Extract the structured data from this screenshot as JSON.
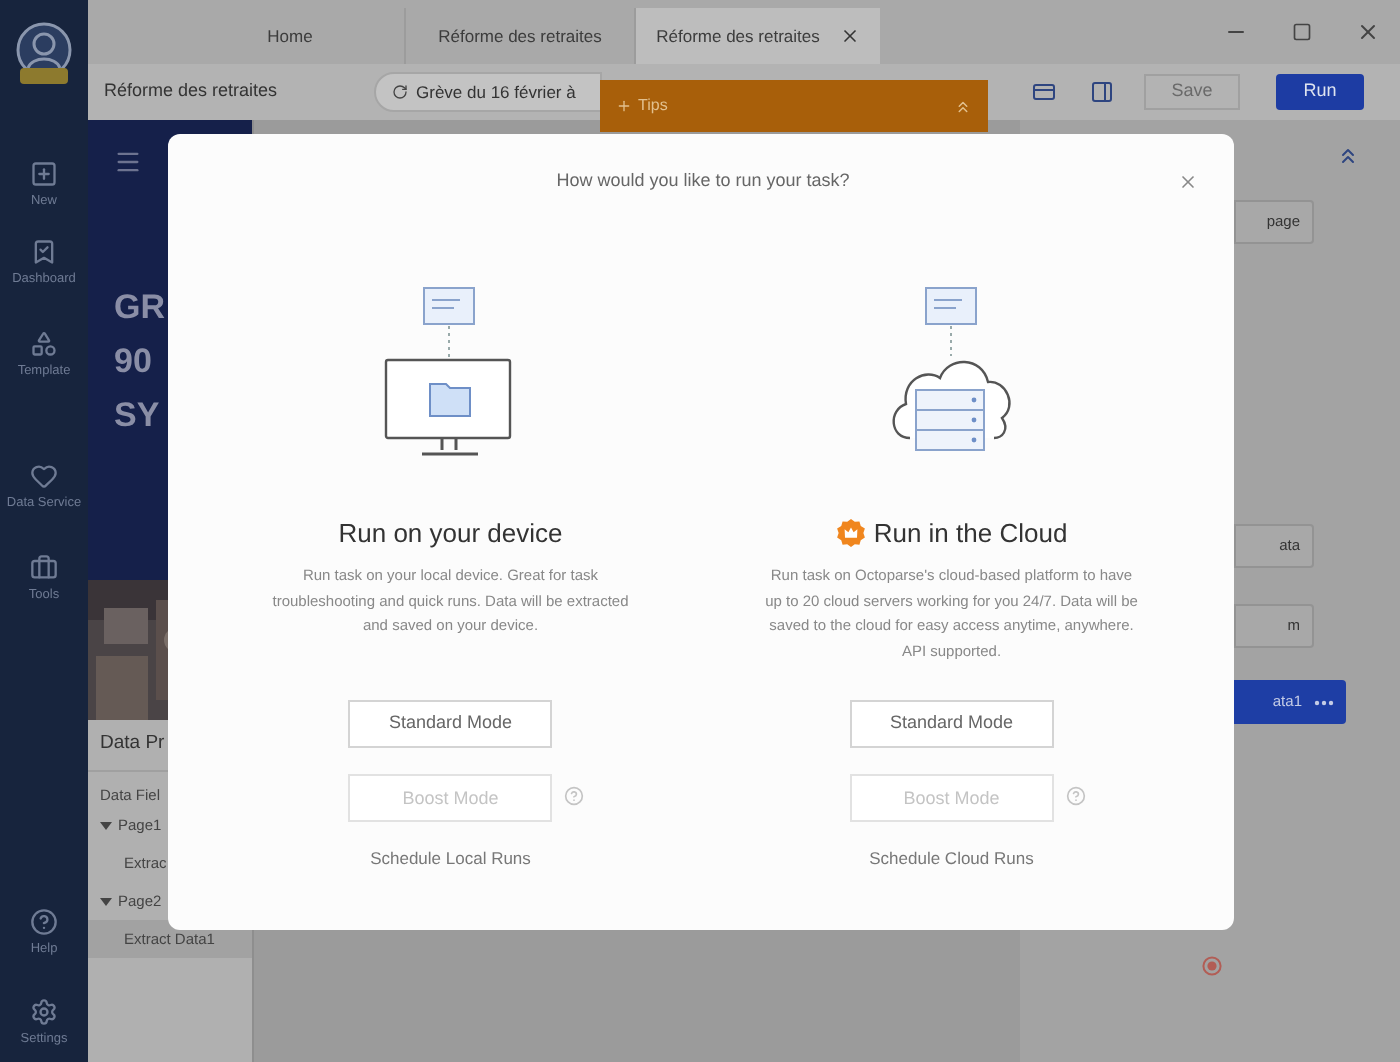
{
  "sidebar": {
    "items": [
      {
        "label": "New"
      },
      {
        "label": "Dashboard"
      },
      {
        "label": "Template"
      },
      {
        "label": "Data Service"
      },
      {
        "label": "Tools"
      }
    ],
    "bottom_items": [
      {
        "label": "Help"
      },
      {
        "label": "Settings"
      }
    ]
  },
  "tabs": [
    {
      "label": "Home",
      "selected": false
    },
    {
      "label": "Réforme des retraites",
      "selected": false
    },
    {
      "label": "Réforme des retraites",
      "selected": true
    }
  ],
  "toolbar": {
    "task_name": "Réforme des retraites",
    "url": "Grève du 16 février à",
    "save": {
      "label": "Save",
      "disabled": true
    },
    "run": {
      "label": "Run",
      "disabled": false
    }
  },
  "tips": {
    "label": "Tips"
  },
  "preview": {
    "headline": [
      "GR",
      "90",
      "SY"
    ]
  },
  "data_panel": {
    "title": "Data Pr",
    "header": "Data Fiel",
    "tree": [
      {
        "label": "Page1",
        "expanded": true,
        "children": [
          {
            "label": "Extrac",
            "selected": false
          }
        ]
      },
      {
        "label": "Page2",
        "expanded": true,
        "children": [
          {
            "label": "Extract Data1",
            "selected": true
          }
        ]
      }
    ]
  },
  "workflow": {
    "steps": [
      {
        "label": "page",
        "selected": false
      },
      {
        "label": "ata",
        "selected": false
      },
      {
        "label": "m",
        "selected": false
      },
      {
        "label": "ata1",
        "selected": true
      }
    ]
  },
  "dialog": {
    "title": "How would you like to run your task?",
    "options": [
      {
        "kind": "local",
        "heading": "Run on your device",
        "description": "Run task on your local device. Great for task troubleshooting and quick runs. Data will be extracted and saved on your device.",
        "standard": {
          "label": "Standard Mode",
          "disabled": false
        },
        "boost": {
          "label": "Boost Mode",
          "disabled": true
        },
        "schedule": "Schedule Local Runs"
      },
      {
        "kind": "cloud",
        "heading": "Run in the Cloud",
        "description": "Run task on Octoparse's cloud-based platform to have up to 20 cloud servers working for you 24/7. Data will be saved to the cloud for easy access anytime, anywhere. API supported.",
        "standard": {
          "label": "Standard Mode",
          "disabled": false
        },
        "boost": {
          "label": "Boost Mode",
          "disabled": true
        },
        "schedule": "Schedule Cloud Runs"
      }
    ]
  }
}
